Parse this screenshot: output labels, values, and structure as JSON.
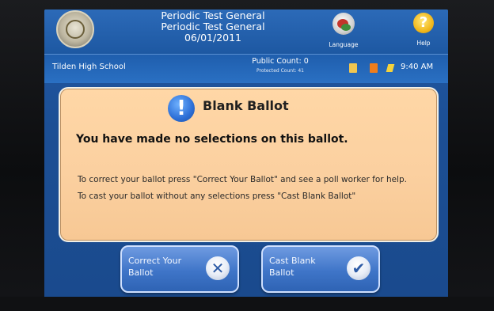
{
  "header": {
    "title_line1": "Periodic Test General",
    "title_line2": "Periodic Test General",
    "date": "06/01/2011",
    "language_label": "Language",
    "help_label": "Help"
  },
  "status": {
    "location": "Tilden High School",
    "public_count": "Public Count: 0",
    "protected_count": "Protected Count: 41",
    "time": "9:40 AM"
  },
  "dialog": {
    "title": "Blank Ballot",
    "headline": "You have made no selections on this ballot.",
    "body_1": "To correct your ballot press \"Correct Your Ballot\" and see a poll worker for help.",
    "body_2": "To cast your ballot without any selections press \"Cast Blank Ballot\""
  },
  "buttons": {
    "correct_line1": "Correct Your",
    "correct_line2": "Ballot",
    "cast_line1": "Cast Blank",
    "cast_line2": "Ballot"
  },
  "icons": {
    "seal": "seal-icon",
    "language": "language-globe-icon",
    "help": "help-question-icon",
    "alert": "info-exclamation-icon",
    "correct": "x-icon",
    "cast": "checkmark-icon"
  },
  "colors": {
    "screen_blue": "#1f5ead",
    "dialog_peach": "#fbd0a0",
    "button_blue": "#3f75c8",
    "help_yellow": "#f1b81d"
  }
}
